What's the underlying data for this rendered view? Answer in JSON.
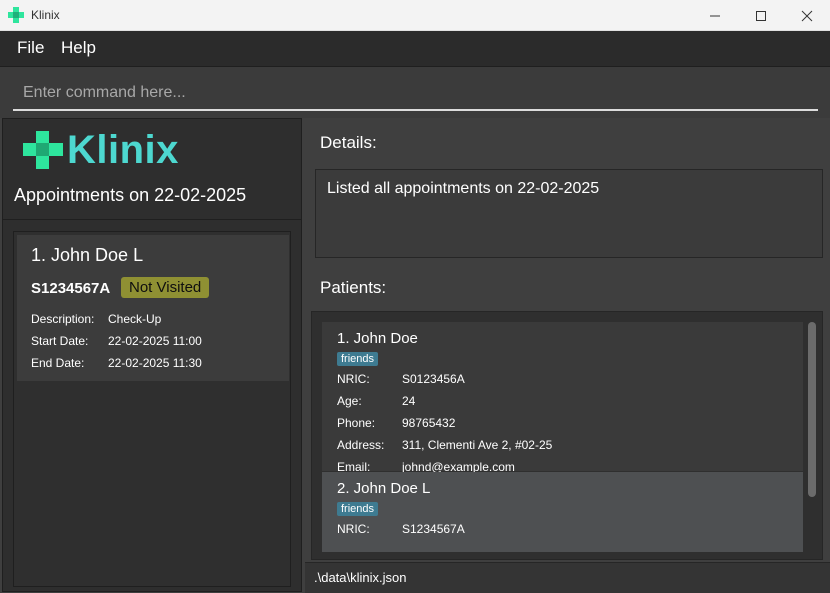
{
  "window": {
    "title": "Klinix",
    "app_icon": "klinix-cross-icon",
    "controls": [
      "minimize-icon",
      "maximize-icon",
      "close-icon"
    ]
  },
  "menu": {
    "file": "File",
    "help": "Help"
  },
  "command": {
    "placeholder": "Enter command here...",
    "value": ""
  },
  "left": {
    "logo_text": "Klinix",
    "heading": "Appointments on 22-02-2025",
    "appointments": [
      {
        "name": "1. John Doe L",
        "nric": "S1234567A",
        "status": "Not Visited",
        "description_label": "Description:",
        "description": "Check-Up",
        "start_label": "Start Date:",
        "start": "22-02-2025 11:00",
        "end_label": "End Date:",
        "end": "22-02-2025 11:30"
      }
    ]
  },
  "right": {
    "details_label": "Details:",
    "details_text": "Listed all appointments on 22-02-2025",
    "patients_label": "Patients:",
    "patients": [
      {
        "name": "1. John Doe",
        "tag": "friends",
        "nric_label": "NRIC:",
        "nric": "S0123456A",
        "age_label": "Age:",
        "age": "24",
        "phone_label": "Phone:",
        "phone": "98765432",
        "address_label": "Address:",
        "address": "311, Clementi Ave 2, #02-25",
        "email_label": "Email:",
        "email": "johnd@example.com"
      },
      {
        "name": "2. John Doe L",
        "tag": "friends",
        "nric_label": "NRIC:",
        "nric": "S1234567A"
      }
    ]
  },
  "status_bar": {
    "path": ".\\data\\klinix.json"
  },
  "colors": {
    "accent_green": "#2ee59d",
    "accent_teal": "#4dd8d0",
    "status_badge": "#8f9033",
    "tag": "#3e7b91",
    "background": "#3f3f3f"
  }
}
